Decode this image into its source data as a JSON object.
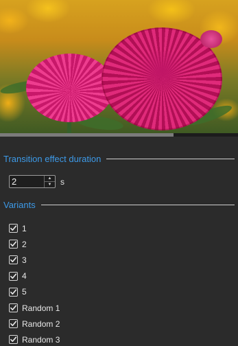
{
  "preview": {
    "image_alt": "Pink thistle flowers on yellow floral background",
    "progress_percent": 73
  },
  "transition": {
    "title": "Transition effect duration",
    "value": "2",
    "unit": "s"
  },
  "variants": {
    "title": "Variants",
    "items": [
      {
        "label": "1",
        "checked": true
      },
      {
        "label": "2",
        "checked": true
      },
      {
        "label": "3",
        "checked": true
      },
      {
        "label": "4",
        "checked": true
      },
      {
        "label": "5",
        "checked": true
      },
      {
        "label": "Random 1",
        "checked": true
      },
      {
        "label": "Random 2",
        "checked": true
      },
      {
        "label": "Random 3",
        "checked": true
      }
    ]
  },
  "colors": {
    "accent": "#3d9ae8",
    "background": "#2b2b2b"
  },
  "icons": {
    "spin_up": "chevron-up-icon",
    "spin_down": "chevron-down-icon",
    "check": "checkmark-icon"
  }
}
